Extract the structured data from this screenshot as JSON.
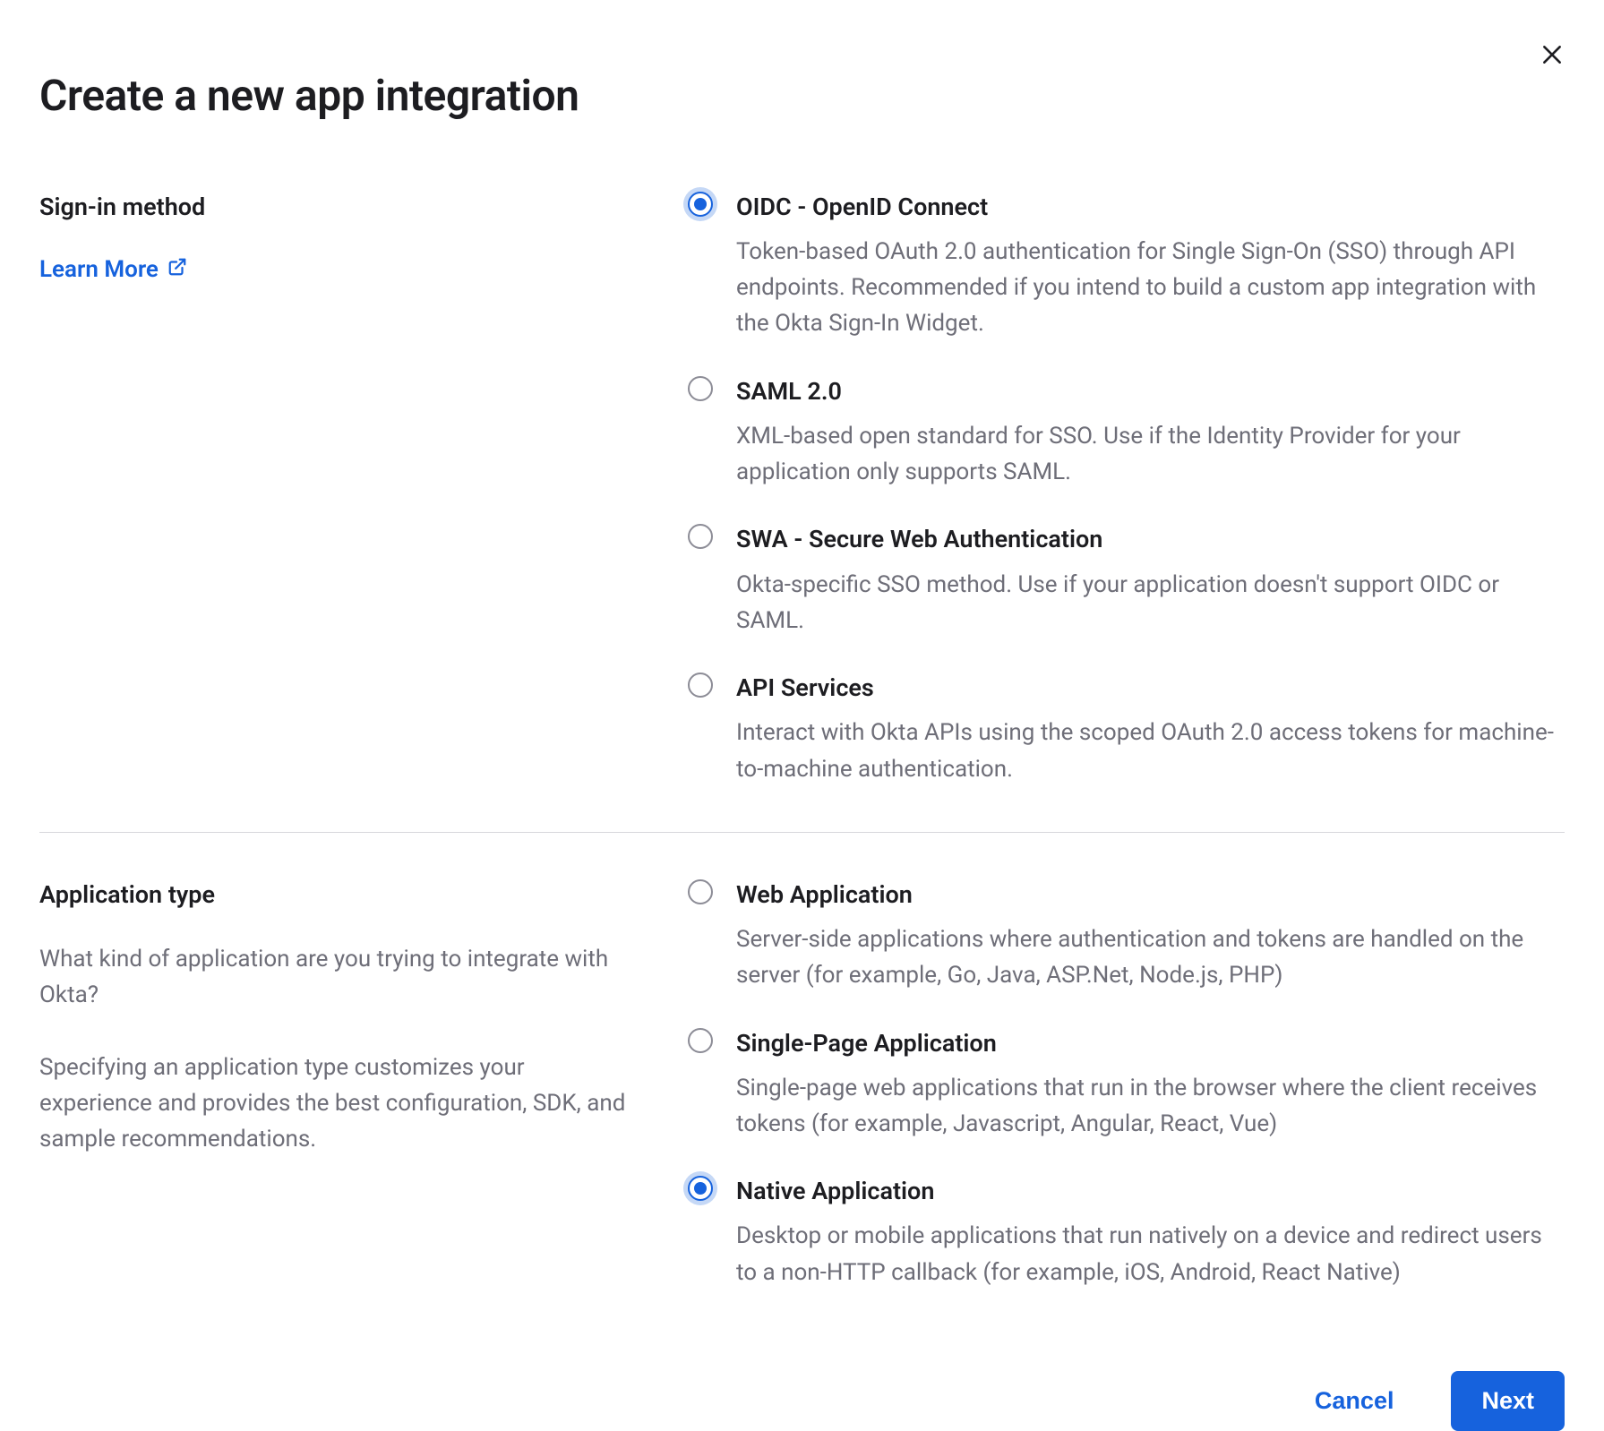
{
  "title": "Create a new app integration",
  "close_icon": "close",
  "sections": {
    "signin": {
      "heading": "Sign-in method",
      "learn_more": "Learn More",
      "options": [
        {
          "label": "OIDC - OpenID Connect",
          "desc": "Token-based OAuth 2.0 authentication for Single Sign-On (SSO) through API endpoints. Recommended if you intend to build a custom app integration with the Okta Sign-In Widget.",
          "selected": true
        },
        {
          "label": "SAML 2.0",
          "desc": "XML-based open standard for SSO. Use if the Identity Provider for your application only supports SAML.",
          "selected": false
        },
        {
          "label": "SWA - Secure Web Authentication",
          "desc": "Okta-specific SSO method. Use if your application doesn't support OIDC or SAML.",
          "selected": false
        },
        {
          "label": "API Services",
          "desc": "Interact with Okta APIs using the scoped OAuth 2.0 access tokens for machine-to-machine authentication.",
          "selected": false
        }
      ]
    },
    "apptype": {
      "heading": "Application type",
      "desc1": "What kind of application are you trying to integrate with Okta?",
      "desc2": "Specifying an application type customizes your experience and provides the best configuration, SDK, and sample recommendations.",
      "options": [
        {
          "label": "Web Application",
          "desc": "Server-side applications where authentication and tokens are handled on the server (for example, Go, Java, ASP.Net, Node.js, PHP)",
          "selected": false
        },
        {
          "label": "Single-Page Application",
          "desc": "Single-page web applications that run in the browser where the client receives tokens (for example, Javascript, Angular, React, Vue)",
          "selected": false
        },
        {
          "label": "Native Application",
          "desc": "Desktop or mobile applications that run natively on a device and redirect users to a non-HTTP callback (for example, iOS, Android, React Native)",
          "selected": true
        }
      ]
    }
  },
  "footer": {
    "cancel": "Cancel",
    "next": "Next"
  }
}
